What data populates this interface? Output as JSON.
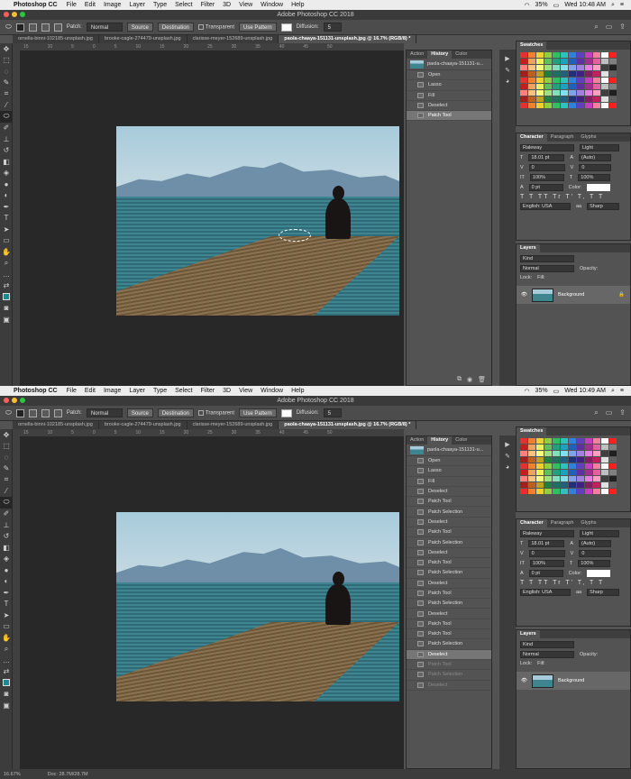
{
  "app": {
    "apple": "",
    "name": "Photoshop CC",
    "menus": [
      "File",
      "Edit",
      "Image",
      "Layer",
      "Type",
      "Select",
      "Filter",
      "3D",
      "View",
      "Window",
      "Help"
    ],
    "title": "Adobe Photoshop CC 2018",
    "battery": "35%"
  },
  "options": {
    "patch_label": "Patch:",
    "patch_value": "Normal",
    "source": "Source",
    "destination": "Destination",
    "transparent": "Transparent",
    "use_pattern": "Use Pattern",
    "diffusion_label": "Diffusion:",
    "diffusion_value": "5"
  },
  "doc_tabs": [
    "ornella-binni-102185-unsplash.jpg",
    "brooke-cagle-274479-unsplash.jpg",
    "clarisse-meyer-152689-unsplash.jpg",
    "paola-chaaya-151131-unsplash.jpg @ 16.7% (RGB/8) *"
  ],
  "panel_tabs": {
    "actions": "Action",
    "history": "History",
    "color": "Color",
    "swatches": "Swatches",
    "character": "Character",
    "paragraph": "Paragraph",
    "glyphs": "Glyphs",
    "layers": "Layers"
  },
  "shotA": {
    "time": "Wed 10:48 AM",
    "history": [
      "Open",
      "Lasso",
      "Fill",
      "Deselect",
      "Patch Tool"
    ]
  },
  "shotB": {
    "time": "Wed 10:49 AM",
    "history": [
      "Open",
      "Lasso",
      "Fill",
      "Deselect",
      "Patch Tool",
      "Patch Selection",
      "Deselect",
      "Patch Tool",
      "Patch Selection",
      "Deselect",
      "Patch Tool",
      "Patch Selection",
      "Deselect",
      "Patch Tool",
      "Patch Selection",
      "Deselect",
      "Patch Tool",
      "Patch Tool",
      "Patch Selection",
      "Deselect",
      "Patch Tool",
      "Patch Selection",
      "Deselect"
    ],
    "current_index": 19
  },
  "history_snapshot": "paola-chaaya-151131-u...",
  "character": {
    "font": "Raleway",
    "style": "Light",
    "size": "18.01 pt",
    "leading": "(Auto)",
    "tracking": "0",
    "kerning": "0",
    "vscale": "100%",
    "hscale": "100%",
    "baseline": "0 pt",
    "color_label": "Color:",
    "language": "English: USA",
    "aa": "Sharp",
    "glyph_row": "T T TT Tr T' T, T T"
  },
  "layers": {
    "kind": "Kind",
    "mode": "Normal",
    "opacity": "Opacity:",
    "lock": "Lock:",
    "fill": "Fill:",
    "layer_name": "Background"
  },
  "status": {
    "zoom": "16.67%",
    "doc": "Doc: 28.7M/28.7M"
  },
  "ruler_marks": [
    "15",
    "10",
    "5",
    "0",
    "5",
    "10",
    "15",
    "20",
    "25",
    "30",
    "35",
    "40",
    "45",
    "50"
  ],
  "colors": {
    "swatches": [
      "#e63030",
      "#f08030",
      "#f0d030",
      "#90d040",
      "#30c060",
      "#30c0c0",
      "#3080e0",
      "#6040c0",
      "#c040c0",
      "#f080a0",
      "#ffffff",
      "#ff2020",
      "#c02020",
      "#f0a060",
      "#f0f060",
      "#60c060",
      "#20a080",
      "#20a0c0",
      "#2060c0",
      "#6030a0",
      "#a03090",
      "#e060a0",
      "#c0c0c0",
      "#808080",
      "#ff8080",
      "#ffc080",
      "#ffff80",
      "#a0e080",
      "#80e0c0",
      "#80e0f0",
      "#80a0f0",
      "#a080e0",
      "#e080e0",
      "#ffa0c0",
      "#404040",
      "#202020",
      "#a02020",
      "#c06020",
      "#c0a020",
      "#208040",
      "#207060",
      "#206080",
      "#203080",
      "#402080",
      "#802060",
      "#c02060",
      "#e0e0e0",
      "#606060"
    ]
  }
}
